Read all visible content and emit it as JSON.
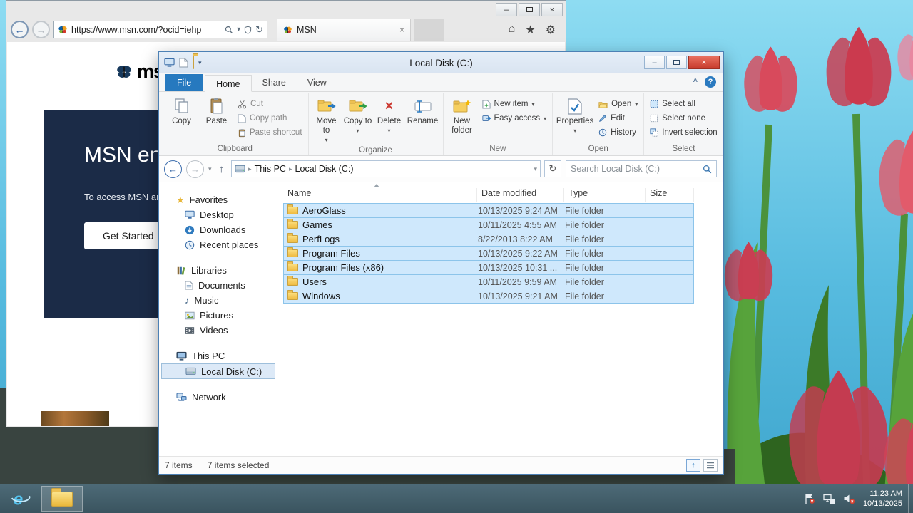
{
  "icons": {
    "minimize": "–",
    "close": "×",
    "back": "←",
    "forward": "→",
    "up": "↑",
    "chevron_down": "▾",
    "chevron_right": "▸",
    "refresh": "↻",
    "home": "⌂",
    "favorites_star": "★",
    "settings_gear": "⚙",
    "collapse_ribbon": "^",
    "help": "?",
    "music_note": "♪",
    "star": "★"
  },
  "colors": {
    "accent_blue": "#2a7ac0",
    "selection_fill": "#cfe8fc",
    "selection_border": "#8cc4ea",
    "folder_yellow": "#efbb42",
    "taskbar": "#42606d",
    "sky": "#57bbdf",
    "tulip_red": "#cb3a4e"
  },
  "ie": {
    "url": "https://www.msn.com/?ocid=iehp",
    "tab": "MSN",
    "logo_text": "msn",
    "hero_title": "MSN en",
    "hero_body": "To access MSN and",
    "cta_label": "Get Started"
  },
  "explorer": {
    "title": "Local Disk (C:)",
    "tabs": {
      "file": "File",
      "home": "Home",
      "share": "Share",
      "view": "View"
    },
    "ribbon": {
      "copy": "Copy",
      "paste": "Paste",
      "cut": "Cut",
      "copy_path": "Copy path",
      "paste_shortcut": "Paste shortcut",
      "clipboard_group": "Clipboard",
      "move_to": "Move to",
      "copy_to": "Copy to",
      "delete": "Delete",
      "rename": "Rename",
      "organize_group": "Organize",
      "new_folder": "New folder",
      "new_item": "New item",
      "easy_access": "Easy access",
      "new_group": "New",
      "properties": "Properties",
      "open": "Open",
      "edit": "Edit",
      "history": "History",
      "open_group": "Open",
      "select_all": "Select all",
      "select_none": "Select none",
      "invert_selection": "Invert selection",
      "select_group": "Select"
    },
    "nav": {
      "breadcrumb_root": "This PC",
      "breadcrumb_current": "Local Disk (C:)",
      "search_placeholder": "Search Local Disk (C:)"
    },
    "sidebar": {
      "favorites": {
        "label": "Favorites",
        "items": [
          "Desktop",
          "Downloads",
          "Recent places"
        ]
      },
      "libraries": {
        "label": "Libraries",
        "items": [
          "Documents",
          "Music",
          "Pictures",
          "Videos"
        ]
      },
      "thispc": {
        "label": "This PC",
        "items": [
          "Local Disk (C:)"
        ]
      },
      "network": {
        "label": "Network"
      }
    },
    "columns": {
      "name": "Name",
      "date": "Date modified",
      "type": "Type",
      "size": "Size"
    },
    "files": [
      {
        "name": "AeroGlass",
        "date": "10/13/2025 9:24 AM",
        "type": "File folder",
        "size": ""
      },
      {
        "name": "Games",
        "date": "10/11/2025 4:55 AM",
        "type": "File folder",
        "size": ""
      },
      {
        "name": "PerfLogs",
        "date": "8/22/2013 8:22 AM",
        "type": "File folder",
        "size": ""
      },
      {
        "name": "Program Files",
        "date": "10/13/2025 9:22 AM",
        "type": "File folder",
        "size": ""
      },
      {
        "name": "Program Files (x86)",
        "date": "10/13/2025 10:31 ...",
        "type": "File folder",
        "size": ""
      },
      {
        "name": "Users",
        "date": "10/11/2025 9:59 AM",
        "type": "File folder",
        "size": ""
      },
      {
        "name": "Windows",
        "date": "10/13/2025 9:21 AM",
        "type": "File folder",
        "size": ""
      }
    ],
    "status": {
      "count": "7 items",
      "selected": "7 items selected"
    }
  },
  "taskbar": {
    "time": "11:23 AM",
    "date": "10/13/2025"
  }
}
